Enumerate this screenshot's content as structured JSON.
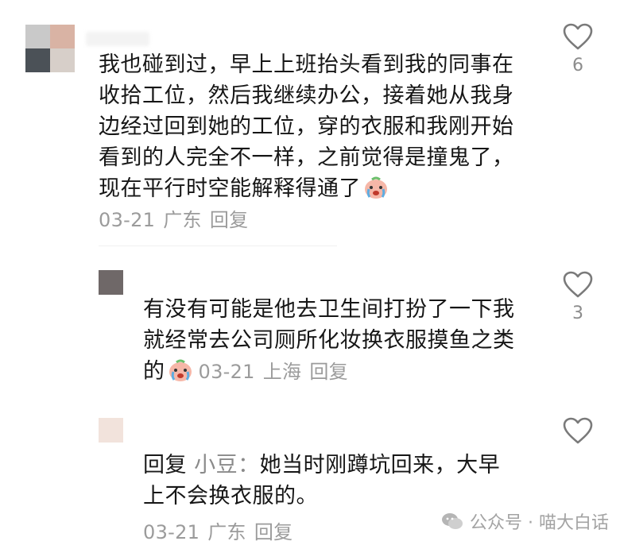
{
  "comments": [
    {
      "text": "我也碰到过，早上上班抬头看到我的同事在收拾工位，然后我继续办公，接着她从我身边经过回到她的工位，穿的衣服和我刚开始看到的人完全不一样，之前觉得是撞鬼了，现在平行时空能解释得通了",
      "emoji": "crying-face-emoji",
      "date": "03-21",
      "location": "广东",
      "reply_label": "回复",
      "likes": "6"
    },
    {
      "text": "有没有可能是他去卫生间打扮了一下我就经常去公司厕所化妆换衣服摸鱼之类的",
      "emoji": "crying-face-emoji",
      "date": "03-21",
      "location": "上海",
      "reply_label": "回复",
      "likes": "3"
    },
    {
      "reply_prefix": "回复",
      "reply_to": "小豆：",
      "text": "她当时刚蹲坑回来，大早上不会换衣服的。",
      "date": "03-21",
      "location": "广东",
      "reply_label": "回复",
      "likes": ""
    }
  ],
  "watermark": {
    "label": "公众号 · 喵大白话"
  },
  "colors": {
    "text": "#161616",
    "meta": "#9b9b9b",
    "icon": "#7a7a7a"
  }
}
